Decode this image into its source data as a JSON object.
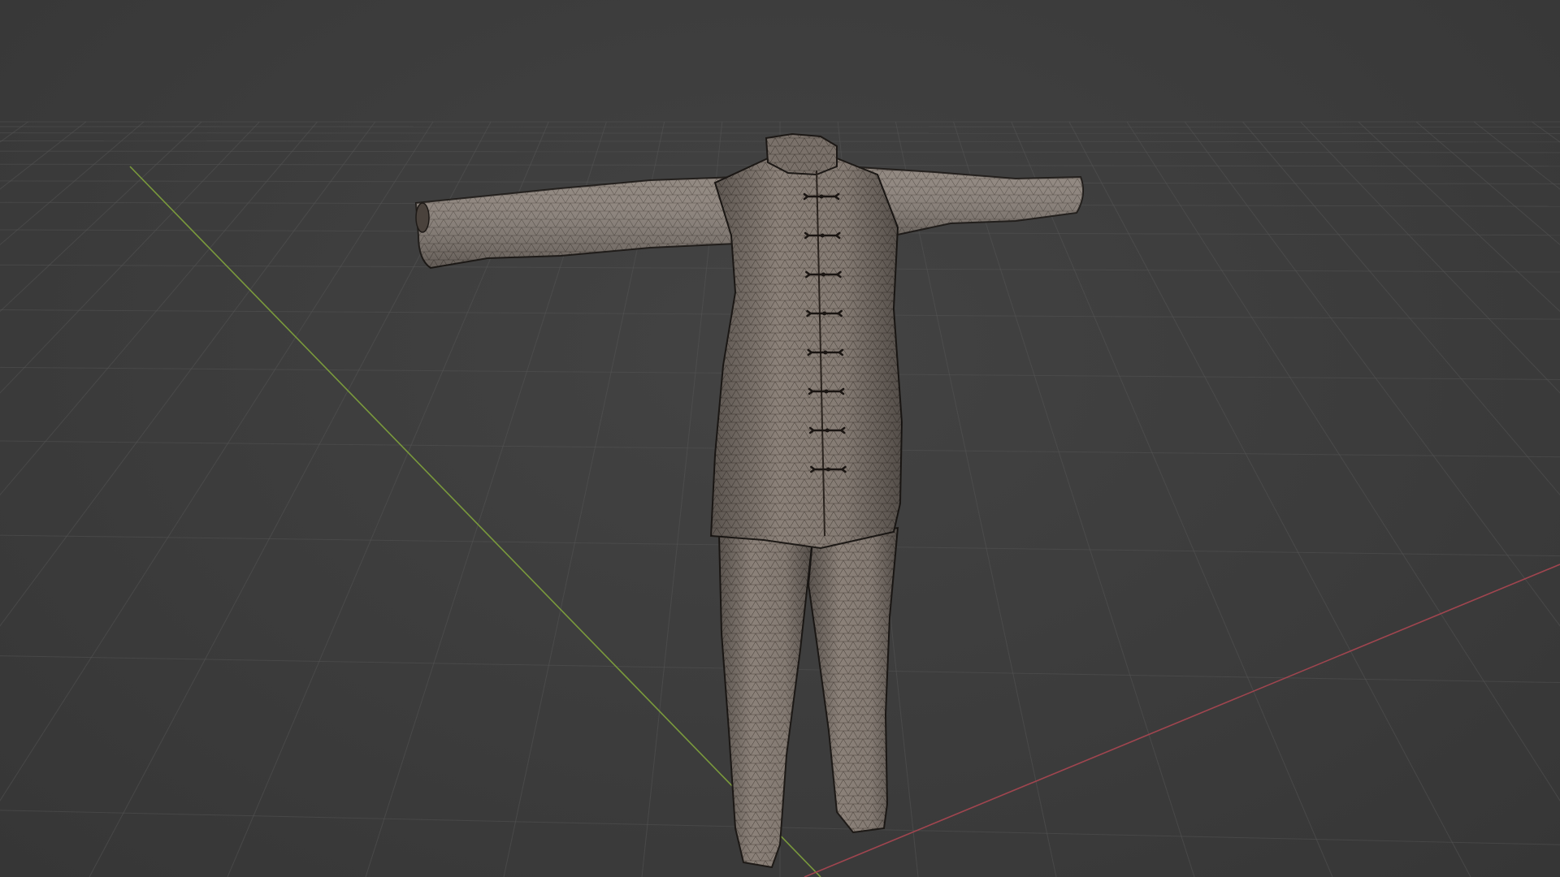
{
  "viewport": {
    "background_color": "#3d3d3d",
    "grid_color": "#555555",
    "x_axis_color": "#a0454f",
    "y_axis_color": "#7a9a3c",
    "mesh": {
      "object": "garment",
      "parts": [
        "jacket",
        "trousers",
        "frog-button-closures"
      ],
      "surface_color": "#8a8078",
      "wire_color": "#2a2420",
      "button_count": 8
    }
  }
}
